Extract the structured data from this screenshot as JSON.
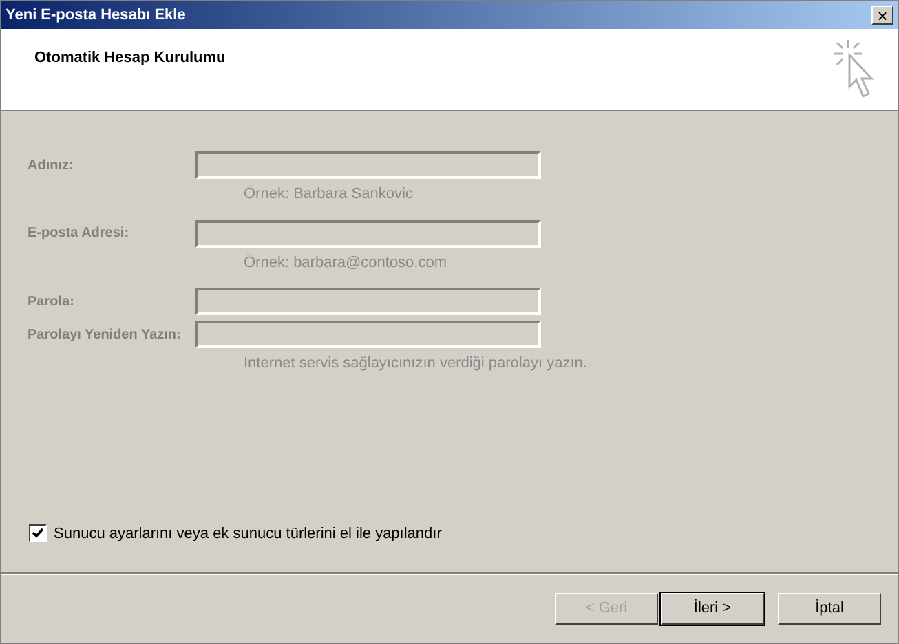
{
  "window": {
    "title": "Yeni E-posta Hesabı Ekle",
    "close": "×"
  },
  "header": {
    "title": "Otomatik Hesap Kurulumu"
  },
  "fields": [
    {
      "label": "Adınız:",
      "disabled": true,
      "hint": "Örnek: Barbara Sankovic"
    },
    {
      "label": "E-posta Adresi:",
      "disabled": true,
      "hint": "Örnek: barbara@contoso.com"
    },
    {
      "label": "Parola:",
      "disabled": true
    },
    {
      "label": "Parolayı Yeniden Yazın:",
      "disabled": true,
      "hint": "Internet servis sağlayıcınızın verdiği parolayı yazın."
    }
  ],
  "manual_setup": {
    "label": "Sunucu ayarlarını veya ek sunucu türlerini el ile yapılandır",
    "checked": true
  },
  "buttons": [
    {
      "label": "< Geri",
      "disabled": true,
      "default": false
    },
    {
      "label": "İleri >",
      "disabled": false,
      "default": true
    },
    {
      "label": "İptal",
      "disabled": false,
      "default": false
    }
  ]
}
